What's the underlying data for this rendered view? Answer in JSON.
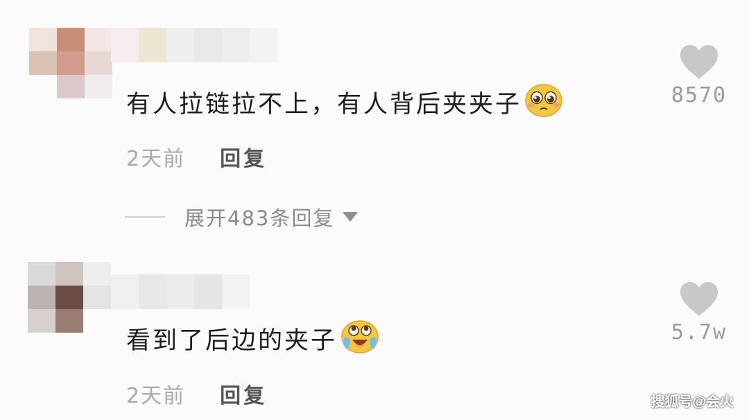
{
  "comments": [
    {
      "text": "有人拉链拉不上，有人背后夹夹子",
      "emoji": "pleading-face-emoji",
      "time": "2天前",
      "reply_label": "回复",
      "likes": "8570",
      "expand_label": "展开483条回复"
    },
    {
      "text": "看到了后边的夹子",
      "emoji": "laughing-crying-face-emoji",
      "time": "2天前",
      "reply_label": "回复",
      "likes": "5.7w"
    }
  ],
  "watermark": "搜狐号@会火",
  "colors": {
    "heart": "#c8c8c8",
    "text": "#1d1d1d",
    "muted": "#a9a9a9",
    "emoji_yellow": "#f6c640"
  }
}
